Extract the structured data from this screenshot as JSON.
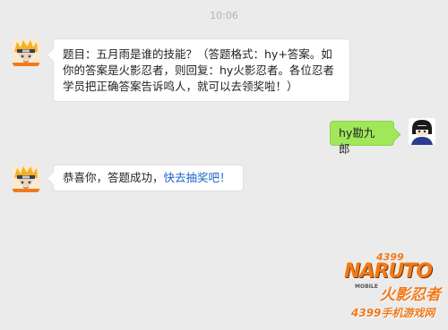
{
  "timestamp": "10:06",
  "messages": [
    {
      "sender": "bot",
      "text": "题目：五月雨是谁的技能？（答题格式：hy+答案。如\n你的答案是火影忍者，则回复：hy火影忍者。各位忍者\n学员把正确答案告诉鸣人，就可以去领奖啦！）"
    },
    {
      "sender": "user",
      "text": "hy勘九郎"
    },
    {
      "sender": "bot",
      "text_prefix": "恭喜你，答题成功，",
      "link_text": "快去抽奖吧！"
    }
  ],
  "watermark": {
    "number": "4399",
    "brand": "NARUTO",
    "title": "火影忍者",
    "subtitle": "4399手机游戏网",
    "mobile": "MOBILE"
  },
  "colors": {
    "background": "#ebebeb",
    "bubble_bot": "#ffffff",
    "bubble_user": "#a0e75a",
    "link": "#1a61c9",
    "brand_orange": "#f07a1c"
  }
}
